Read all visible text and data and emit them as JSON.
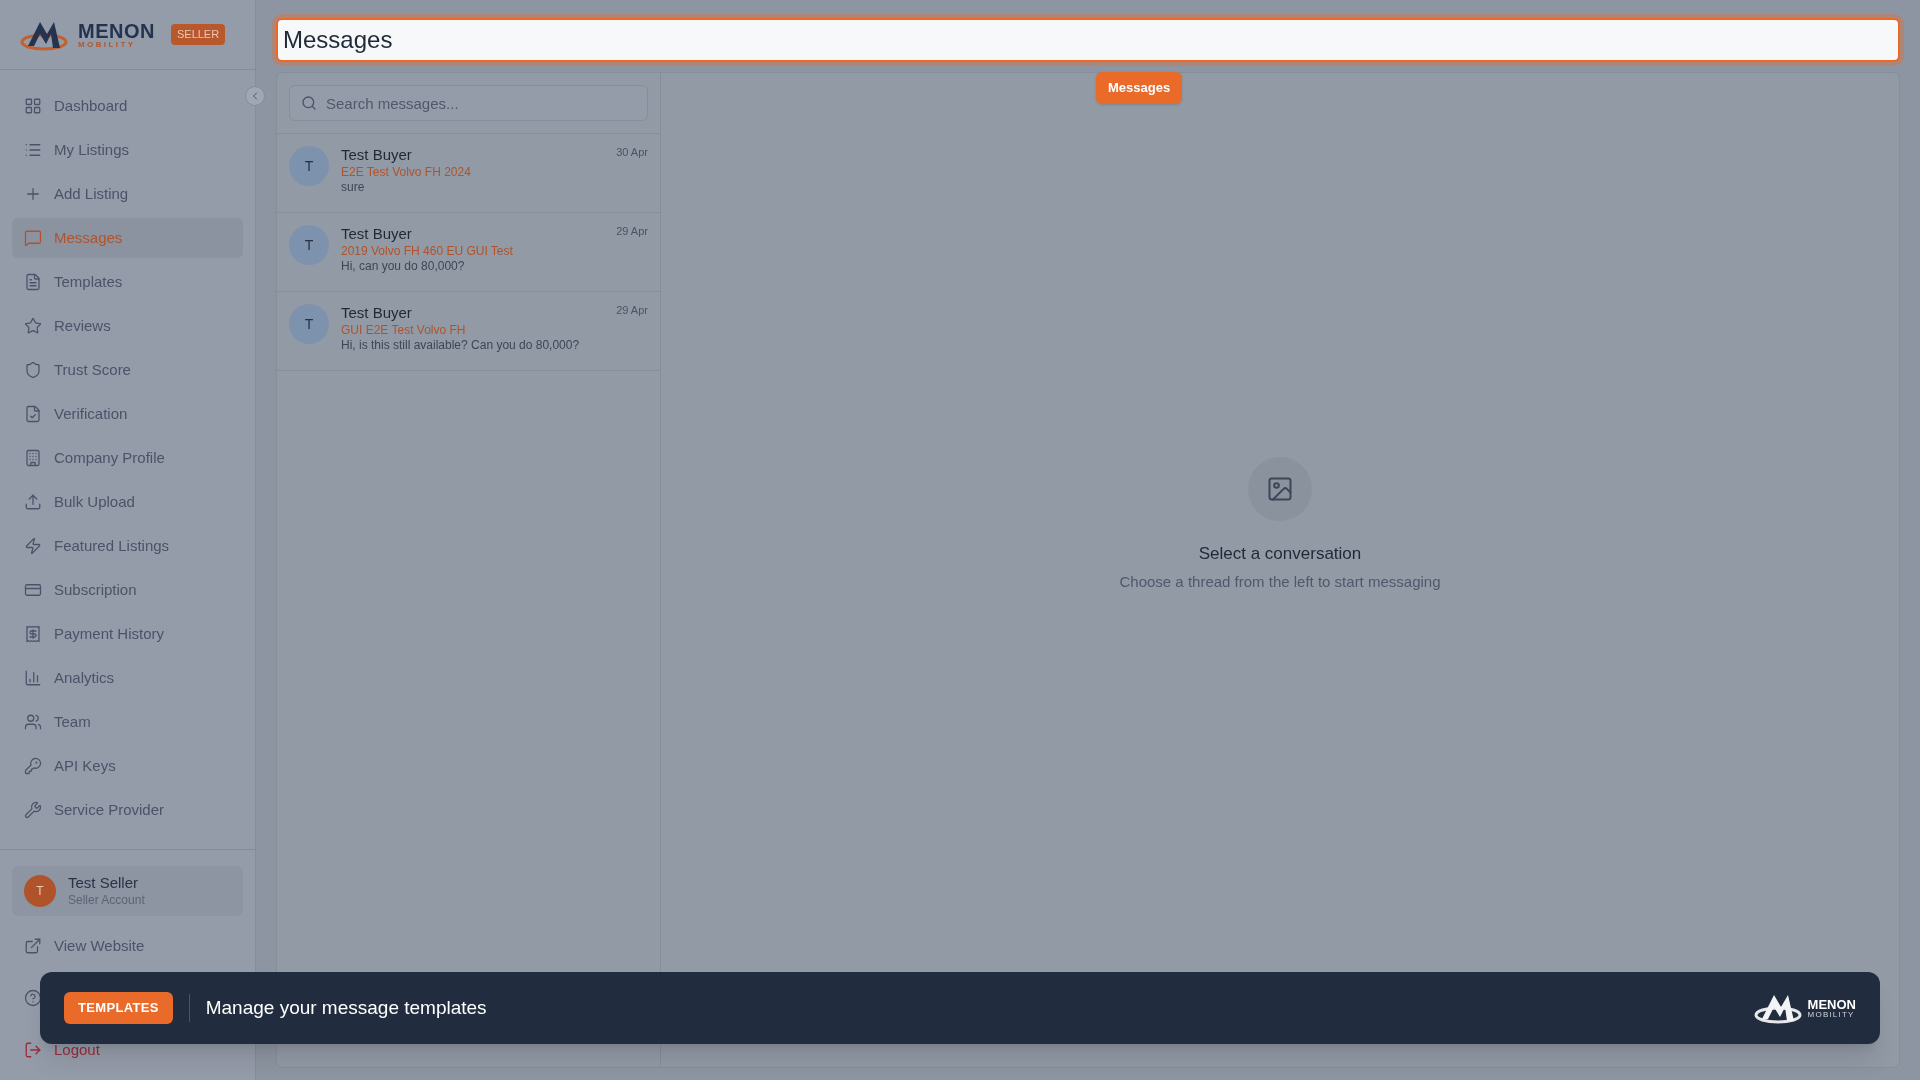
{
  "brand": {
    "name": "MENON",
    "sub": "MOBILITY",
    "badge": "SELLER"
  },
  "nav": [
    {
      "label": "Dashboard",
      "selected": false
    },
    {
      "label": "My Listings",
      "selected": false
    },
    {
      "label": "Add Listing",
      "selected": false
    },
    {
      "label": "Messages",
      "selected": true
    },
    {
      "label": "Templates",
      "selected": false
    },
    {
      "label": "Reviews",
      "selected": false
    },
    {
      "label": "Trust Score",
      "selected": false
    },
    {
      "label": "Verification",
      "selected": false
    },
    {
      "label": "Company Profile",
      "selected": false
    },
    {
      "label": "Bulk Upload",
      "selected": false
    },
    {
      "label": "Featured Listings",
      "selected": false
    },
    {
      "label": "Subscription",
      "selected": false
    },
    {
      "label": "Payment History",
      "selected": false
    },
    {
      "label": "Analytics",
      "selected": false
    },
    {
      "label": "Team",
      "selected": false
    },
    {
      "label": "API Keys",
      "selected": false
    },
    {
      "label": "Service Provider",
      "selected": false
    }
  ],
  "user": {
    "initial": "T",
    "name": "Test Seller",
    "role": "Seller Account"
  },
  "footer_links": [
    {
      "label": "View Website",
      "kind": "link"
    },
    {
      "kind": "help"
    },
    {
      "label": "Logout",
      "kind": "logout"
    }
  ],
  "page_title": "Messages",
  "tooltip": "Messages",
  "search": {
    "placeholder": "Search messages..."
  },
  "threads": [
    {
      "initial": "T",
      "name": "Test Buyer",
      "listing": "E2E Test Volvo FH 2024",
      "preview": "sure",
      "date": "30 Apr"
    },
    {
      "initial": "T",
      "name": "Test Buyer",
      "listing": "2019 Volvo FH 460 EU GUI Test",
      "preview": "Hi, can you do 80,000?",
      "date": "29 Apr"
    },
    {
      "initial": "T",
      "name": "Test Buyer",
      "listing": "GUI E2E Test Volvo FH",
      "preview": "Hi, is this still available? Can you do 80,000?",
      "date": "29 Apr"
    }
  ],
  "empty": {
    "title": "Select a conversation",
    "text": "Choose a thread from the left to start messaging"
  },
  "banner": {
    "tag": "TEMPLATES",
    "text": "Manage your message templates",
    "logo_name": "MENON",
    "logo_sub": "MOBILITY"
  }
}
